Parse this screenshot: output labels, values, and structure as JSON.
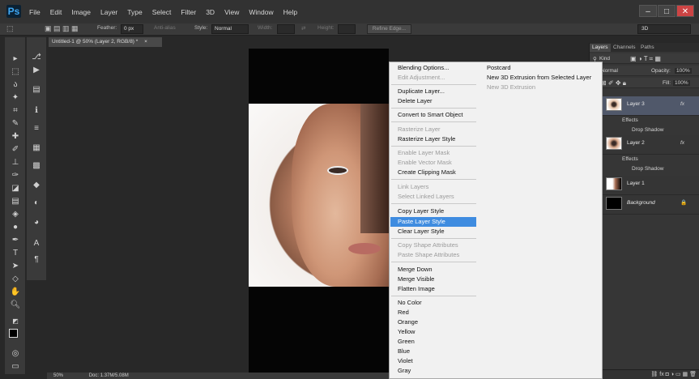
{
  "app": {
    "logo": "Ps",
    "menus": [
      "File",
      "Edit",
      "Image",
      "Layer",
      "Type",
      "Select",
      "Filter",
      "3D",
      "View",
      "Window",
      "Help"
    ],
    "window_controls": [
      "–",
      "□",
      "✕"
    ]
  },
  "options_bar": {
    "feather_label": "Feather:",
    "feather_value": "0 px",
    "anti_alias_label": "Anti-alias",
    "style_label": "Style:",
    "style_value": "Normal",
    "width_label": "Width:",
    "height_label": "Height:",
    "refine_edge_label": "Refine Edge...",
    "workspace_value": "3D"
  },
  "document": {
    "tab_title": "Untitled-1 @ 50% (Layer 2, RGB/8) *",
    "tab_close": "×",
    "zoom": "50%",
    "doc_info": "Doc: 1.37M/5.08M"
  },
  "context_menu": {
    "left_items": [
      {
        "label": "Blending Options...",
        "disabled": false
      },
      {
        "label": "Edit Adjustment...",
        "disabled": true
      },
      {
        "label": "Duplicate Layer...",
        "disabled": false
      },
      {
        "label": "Delete Layer",
        "disabled": false
      },
      {
        "label": "Convert to Smart Object",
        "disabled": false
      },
      {
        "label": "Rasterize Layer",
        "disabled": true
      },
      {
        "label": "Rasterize Layer Style",
        "disabled": false
      },
      {
        "label": "Enable Layer Mask",
        "disabled": true
      },
      {
        "label": "Enable Vector Mask",
        "disabled": true
      },
      {
        "label": "Create Clipping Mask",
        "disabled": false
      },
      {
        "label": "Link Layers",
        "disabled": true
      },
      {
        "label": "Select Linked Layers",
        "disabled": true
      },
      {
        "label": "Copy Layer Style",
        "disabled": false
      },
      {
        "label": "Paste Layer Style",
        "disabled": false,
        "highlighted": true
      },
      {
        "label": "Clear Layer Style",
        "disabled": false
      },
      {
        "label": "Copy Shape Attributes",
        "disabled": true
      },
      {
        "label": "Paste Shape Attributes",
        "disabled": true
      },
      {
        "label": "Merge Down",
        "disabled": false
      },
      {
        "label": "Merge Visible",
        "disabled": false
      },
      {
        "label": "Flatten Image",
        "disabled": false
      },
      {
        "label": "No Color",
        "disabled": false
      },
      {
        "label": "Red",
        "disabled": false
      },
      {
        "label": "Orange",
        "disabled": false
      },
      {
        "label": "Yellow",
        "disabled": false
      },
      {
        "label": "Green",
        "disabled": false
      },
      {
        "label": "Blue",
        "disabled": false
      },
      {
        "label": "Violet",
        "disabled": false
      },
      {
        "label": "Gray",
        "disabled": false
      }
    ],
    "right_items": [
      {
        "label": "Postcard",
        "disabled": false
      },
      {
        "label": "New 3D Extrusion from Selected Layer",
        "disabled": false
      },
      {
        "label": "New 3D Extrusion",
        "disabled": true
      }
    ]
  },
  "layers_panel": {
    "tabs": [
      "Layers",
      "Channels",
      "Paths"
    ],
    "kind_label": "Kind",
    "blend_mode": "Normal",
    "opacity_label": "Opacity:",
    "opacity_value": "100%",
    "lock_label": "Lock:",
    "fill_label": "Fill:",
    "fill_value": "100%",
    "layers": [
      {
        "name": "Layer 3",
        "selected": true,
        "fx": "fx",
        "effects_label": "Effects",
        "effect": "Drop Shadow"
      },
      {
        "name": "Layer 2",
        "selected": false,
        "fx": "fx",
        "effects_label": "Effects",
        "effect": "Drop Shadow"
      },
      {
        "name": "Layer 1",
        "selected": false
      },
      {
        "name": "Background",
        "selected": false,
        "lock": "🔒"
      }
    ],
    "bottom_icons": "⛓ fx ◘ ◑ ▭ ▦ 🗑"
  },
  "colors": {
    "highlight": "#3f8ce0",
    "panel_bg": "#363636",
    "selected_layer": "#50586a"
  }
}
